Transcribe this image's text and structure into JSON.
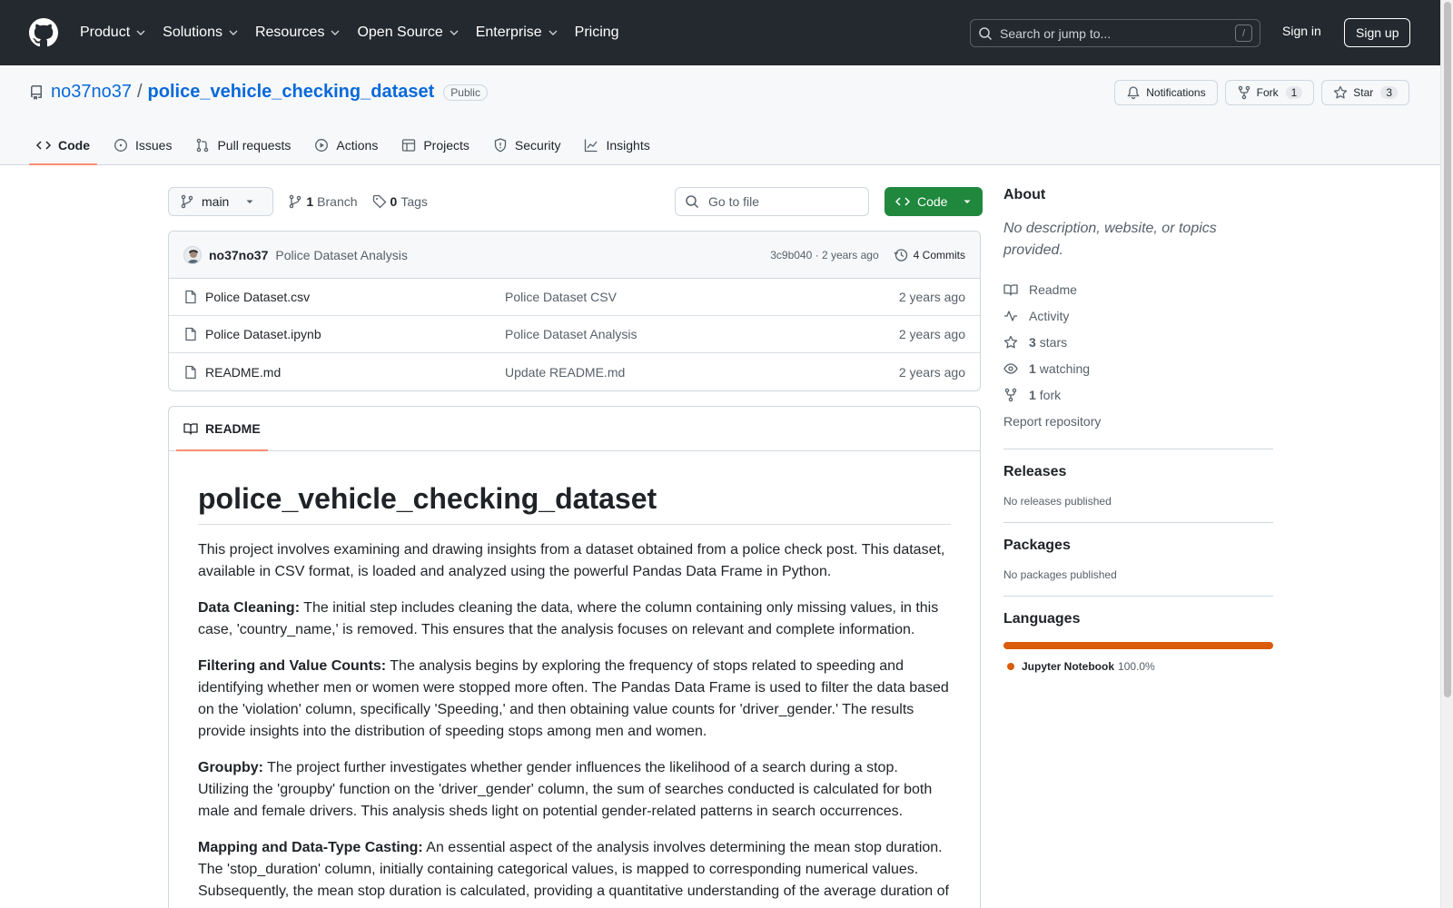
{
  "header": {
    "nav": [
      "Product",
      "Solutions",
      "Resources",
      "Open Source",
      "Enterprise",
      "Pricing"
    ],
    "search_placeholder": "Search or jump to...",
    "search_key": "/",
    "sign_in": "Sign in",
    "sign_up": "Sign up"
  },
  "repo": {
    "owner": "no37no37",
    "separator": "/",
    "name": "police_vehicle_checking_dataset",
    "visibility": "Public",
    "notifications_label": "Notifications",
    "fork_label": "Fork",
    "fork_count": "1",
    "star_label": "Star",
    "star_count": "3",
    "tabs": [
      "Code",
      "Issues",
      "Pull requests",
      "Actions",
      "Projects",
      "Security",
      "Insights"
    ]
  },
  "toolbar": {
    "branch": "main",
    "branch_count": "1",
    "branch_label": "Branch",
    "tag_count": "0",
    "tag_label": "Tags",
    "goto_placeholder": "Go to file",
    "code_label": "Code"
  },
  "commit": {
    "author": "no37no37",
    "message": "Police Dataset Analysis",
    "sha_time": "3c9b040 · 2 years ago",
    "commits": "4 Commits"
  },
  "files": [
    {
      "name": "Police Dataset.csv",
      "message": "Police Dataset CSV",
      "date": "2 years ago"
    },
    {
      "name": "Police Dataset.ipynb",
      "message": "Police Dataset Analysis",
      "date": "2 years ago"
    },
    {
      "name": "README.md",
      "message": "Update README.md",
      "date": "2 years ago"
    }
  ],
  "readme": {
    "tab": "README",
    "title": "police_vehicle_checking_dataset",
    "intro": "This project involves examining and drawing insights from a dataset obtained from a police check post. This dataset, available in CSV format, is loaded and analyzed using the powerful Pandas Data Frame in Python.",
    "sections": [
      {
        "title": "Data Cleaning:",
        "text": " The initial step includes cleaning the data, where the column containing only missing values, in this case, 'country_name,' is removed. This ensures that the analysis focuses on relevant and complete information."
      },
      {
        "title": "Filtering and Value Counts:",
        "text": " The analysis begins by exploring the frequency of stops related to speeding and identifying whether men or women were stopped more often. The Pandas Data Frame is used to filter the data based on the 'violation' column, specifically 'Speeding,' and then obtaining value counts for 'driver_gender.' The results provide insights into the distribution of speeding stops among men and women."
      },
      {
        "title": "Groupby:",
        "text": " The project further investigates whether gender influences the likelihood of a search during a stop. Utilizing the 'groupby' function on the 'driver_gender' column, the sum of searches conducted is calculated for both male and female drivers. This analysis sheds light on potential gender-related patterns in search occurrences."
      },
      {
        "title": "Mapping and Data-Type Casting:",
        "text": " An essential aspect of the analysis involves determining the mean stop duration. The 'stop_duration' column, initially containing categorical values, is mapped to corresponding numerical values. Subsequently, the mean stop duration is calculated, providing a quantitative understanding of the average duration of"
      }
    ]
  },
  "sidebar": {
    "about_title": "About",
    "about_desc": "No description, website, or topics provided.",
    "readme": "Readme",
    "activity": "Activity",
    "stars_count": "3",
    "stars_label": "stars",
    "watching_count": "1",
    "watching_label": "watching",
    "fork_count": "1",
    "fork_label": "fork",
    "report": "Report repository",
    "releases_title": "Releases",
    "releases_text": "No releases published",
    "packages_title": "Packages",
    "packages_text": "No packages published",
    "languages_title": "Languages",
    "language_name": "Jupyter Notebook",
    "language_pct": "100.0%",
    "language_color": "#da5b0b"
  }
}
